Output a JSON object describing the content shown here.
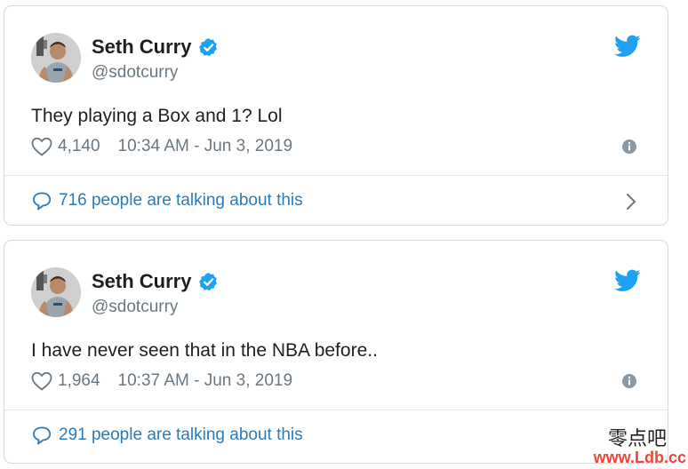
{
  "tweets": [
    {
      "author": "Seth Curry",
      "handle": "@sdotcurry",
      "text": "They playing a Box and 1? Lol",
      "likes": "4,140",
      "timestamp": "10:34 AM - Jun 3, 2019",
      "talking": "716 people are talking about this",
      "show_chevron": true
    },
    {
      "author": "Seth Curry",
      "handle": "@sdotcurry",
      "text": "I have never seen that in the NBA before..",
      "likes": "1,964",
      "timestamp": "10:37 AM - Jun 3, 2019",
      "talking": "291 people are talking about this",
      "show_chevron": false
    }
  ],
  "watermark": {
    "chinese": "零点吧",
    "url": "www.Ldb.cc"
  },
  "colors": {
    "link_blue": "#2b7bb9",
    "twitter_blue": "#1da1f2",
    "meta_gray": "#697882",
    "border": "#d6dbe0",
    "watermark_red": "#e8473a"
  },
  "icons": [
    "avatar",
    "verified-badge-icon",
    "twitter-bird-icon",
    "heart-icon",
    "info-icon",
    "comment-bubble-icon",
    "chevron-right-icon"
  ]
}
